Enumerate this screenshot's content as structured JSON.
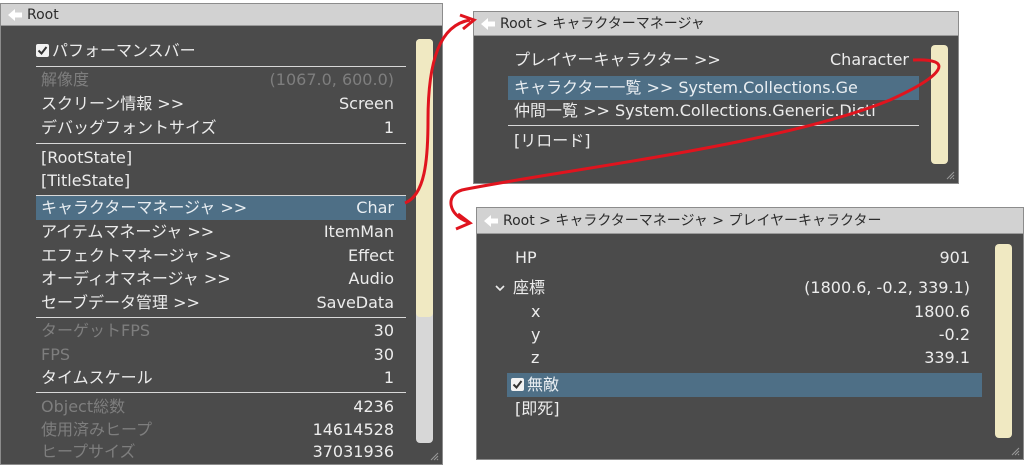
{
  "panel_root": {
    "title": "Root",
    "performance_bar": "パフォーマンスバー",
    "resolution": {
      "label": "解像度",
      "value": "(1067.0, 600.0)"
    },
    "screen_info": {
      "label": "スクリーン情報 >>",
      "value": "Screen"
    },
    "debug_font_size": {
      "label": "デバッグフォントサイズ",
      "value": "1"
    },
    "root_state": "[RootState]",
    "title_state": "[TitleState]",
    "character_manager": {
      "label": "キャラクターマネージャ >>",
      "value": "Char"
    },
    "item_manager": {
      "label": "アイテムマネージャ >>",
      "value": "ItemMan"
    },
    "effect_manager": {
      "label": "エフェクトマネージャ >>",
      "value": "Effect"
    },
    "audio_manager": {
      "label": "オーディオマネージャ >>",
      "value": "Audio"
    },
    "save_data": {
      "label": "セーブデータ管理 >>",
      "value": "SaveData"
    },
    "target_fps": {
      "label": "ターゲットFPS",
      "value": "30"
    },
    "fps": {
      "label": "FPS",
      "value": "30"
    },
    "time_scale": {
      "label": "タイムスケール",
      "value": "1"
    },
    "object_count": {
      "label": "Object総数",
      "value": "4236"
    },
    "used_heap": {
      "label": "使用済みヒープ",
      "value": "14614528"
    },
    "heap_size": {
      "label": "ヒープサイズ",
      "value": "37031936"
    }
  },
  "panel_character": {
    "title": "Root > キャラクターマネージャ",
    "player_character": {
      "label": "プレイヤーキャラクター >>",
      "value": "Character"
    },
    "character_list": "キャラクター一覧 >>   System.Collections.Ge",
    "companion_list": "仲間一覧 >>  System.Collections.Generic.Dicti",
    "reload": "[リロード]"
  },
  "panel_player": {
    "title": "Root > キャラクターマネージャ > プレイヤーキャラクター",
    "hp": {
      "label": "HP",
      "value": "901"
    },
    "position": {
      "label": "座標",
      "value": "(1800.6, -0.2, 339.1)"
    },
    "x": {
      "label": "x",
      "value": "1800.6"
    },
    "y": {
      "label": "y",
      "value": "-0.2"
    },
    "z": {
      "label": "z",
      "value": "339.1"
    },
    "invincible": "無敵",
    "instant_death": "[即死]"
  },
  "colors": {
    "panel_bg": "#4b4b4b",
    "selected_row": "#4e6f86",
    "scrollbar": "#f0e9c2",
    "arrow": "#e0141e"
  },
  "icons": [
    "back-arrow-icon",
    "checkbox-checked-icon",
    "chevron-down-icon",
    "resize-grip-icon"
  ]
}
